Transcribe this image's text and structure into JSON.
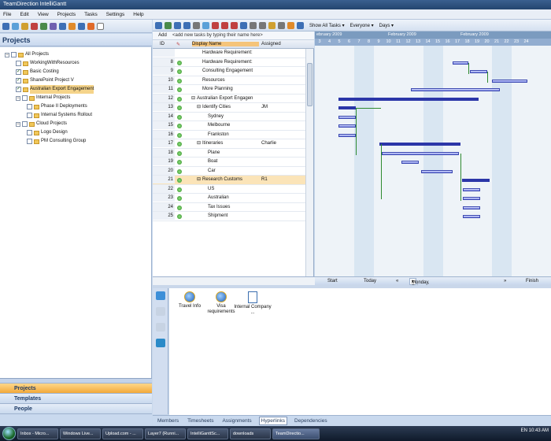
{
  "app": {
    "title": "TeamDirection IntelliGantt"
  },
  "menu": [
    "File",
    "Edit",
    "View",
    "Projects",
    "Tasks",
    "Settings",
    "Help"
  ],
  "projects_pane": {
    "title": "Projects",
    "tree": [
      {
        "label": "All Projects",
        "level": 0,
        "expander": "−",
        "checked": false,
        "folder": true
      },
      {
        "label": "WorkingWithResources",
        "level": 1,
        "checked": false,
        "folder": true
      },
      {
        "label": "Basic Costing",
        "level": 1,
        "checked": true,
        "folder": true
      },
      {
        "label": "SharePoint Project V",
        "level": 1,
        "checked": true,
        "folder": true
      },
      {
        "label": "Australian Export Engagement",
        "level": 1,
        "checked": true,
        "folder": true,
        "selected": true
      },
      {
        "label": "Internal Projects",
        "level": 1,
        "expander": "−",
        "checked": false,
        "folder": true
      },
      {
        "label": "Phase II Deployments",
        "level": 2,
        "checked": false,
        "folder": true
      },
      {
        "label": "Internal Systems Rollout",
        "level": 2,
        "checked": false,
        "folder": true
      },
      {
        "label": "Cloud Projects",
        "level": 1,
        "expander": "−",
        "checked": false,
        "folder": true
      },
      {
        "label": "Logo Design",
        "level": 2,
        "checked": false,
        "folder": true
      },
      {
        "label": "PM Consulting Group",
        "level": 2,
        "checked": false,
        "folder": true
      }
    ],
    "nav": {
      "projects": "Projects",
      "templates": "Templates",
      "people": "People"
    }
  },
  "toolbar": {
    "show_all_tasks": "Show All Tasks",
    "everyone": "Everyone",
    "days": "Days"
  },
  "grid": {
    "add_label": "Add",
    "add_placeholder": "<add new tasks by typing their name here>",
    "headers": {
      "id": "ID",
      "display_name": "Display Name",
      "assigned": "Assigned"
    },
    "rows": [
      {
        "id": "",
        "name": "Hardware Requirement:",
        "assigned": "",
        "indent": 1
      },
      {
        "id": "8",
        "name": "Hardware Requirement:",
        "assigned": "",
        "indent": 1
      },
      {
        "id": "9",
        "name": "Consulting Engagement",
        "assigned": "",
        "indent": 1
      },
      {
        "id": "10",
        "name": "Resources",
        "assigned": "",
        "indent": 1
      },
      {
        "id": "11",
        "name": "More Planning",
        "assigned": "",
        "indent": 1
      },
      {
        "id": "12",
        "name": "Australian Export Engagen",
        "assigned": "",
        "indent": 0,
        "expander": "−"
      },
      {
        "id": "13",
        "name": "Identify Cities",
        "assigned": "JM",
        "indent": 1,
        "expander": "−"
      },
      {
        "id": "14",
        "name": "Sydney",
        "assigned": "",
        "indent": 2
      },
      {
        "id": "15",
        "name": "Melbourne",
        "assigned": "",
        "indent": 2
      },
      {
        "id": "16",
        "name": "Frankston",
        "assigned": "",
        "indent": 2
      },
      {
        "id": "17",
        "name": "Itineraries",
        "assigned": "Charlie",
        "indent": 1,
        "expander": "−"
      },
      {
        "id": "18",
        "name": "Plane",
        "assigned": "",
        "indent": 2
      },
      {
        "id": "19",
        "name": "Boat",
        "assigned": "",
        "indent": 2
      },
      {
        "id": "20",
        "name": "Car",
        "assigned": "",
        "indent": 2
      },
      {
        "id": "21",
        "name": "Research Customs",
        "assigned": "R1",
        "indent": 1,
        "expander": "−",
        "selected": true
      },
      {
        "id": "22",
        "name": "US",
        "assigned": "",
        "indent": 2
      },
      {
        "id": "23",
        "name": "Australian",
        "assigned": "",
        "indent": 2
      },
      {
        "id": "24",
        "name": "Tax Issues",
        "assigned": "",
        "indent": 2
      },
      {
        "id": "25",
        "name": "Shipment",
        "assigned": "",
        "indent": 2
      }
    ]
  },
  "gantt": {
    "months": [
      "ebruary 2009",
      "February 2009",
      "February 2009"
    ],
    "days": [
      "3",
      "4",
      "5",
      "6",
      "7",
      "8",
      "9",
      "10",
      "11",
      "12",
      "13",
      "14",
      "15",
      "16",
      "17",
      "18",
      "19",
      "20",
      "21",
      "22",
      "23",
      "24"
    ],
    "nav": {
      "start": "Start",
      "today": "Today",
      "prev": "«",
      "date": "Monday, February 02, 2009 10:00",
      "next": "»",
      "finish": "Finish"
    }
  },
  "hyperlinks": [
    {
      "label": "Travel Info",
      "icon": "ie-icon"
    },
    {
      "label": "Visa requirements",
      "icon": "ie-icon"
    },
    {
      "label": "Internal Company ...",
      "icon": "document-icon"
    }
  ],
  "bottom_tabs": [
    "Members",
    "Timesheets",
    "Assignments",
    "Hyperlinks",
    "Dependencies"
  ],
  "bottom_tabs_active": "Hyperlinks",
  "taskbar": {
    "items": [
      "Inbox - Micro...",
      "Windows Live...",
      "Upload.com - ...",
      "Layer7 (Runni...",
      "IntelliGanttSc...",
      "downloads",
      "TeamDirectio..."
    ],
    "active": "TeamDirectio...",
    "tray_lang": "EN",
    "clock": "10:43 AM"
  },
  "colors": {
    "accent": "#f3a93a",
    "bar": "#7a86e6",
    "link": "#2f8a2f",
    "summary": "#2b36a8"
  }
}
